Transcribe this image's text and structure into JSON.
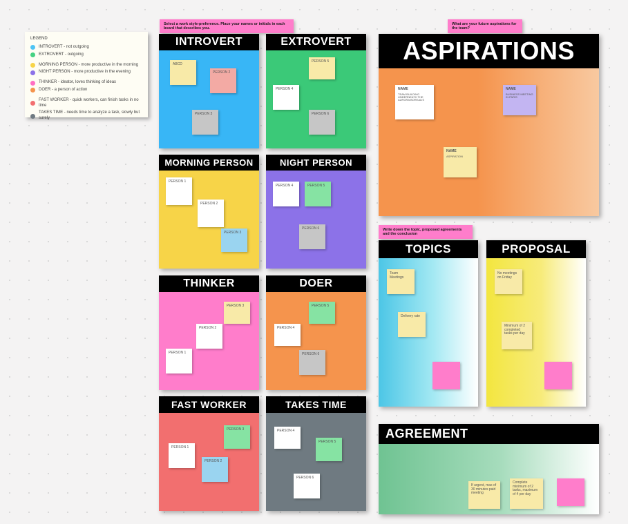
{
  "banners": {
    "workstyle": "Select a work style-preference. Place your names or initials in each board that describes you.",
    "aspirations": "What are your future aspirations for the team?",
    "agreements": "Write down the topic, proposed agreements and the conclusion"
  },
  "legend": {
    "title": "LEGEND",
    "items": [
      {
        "color": "#4fc4f4",
        "text": "INTROVERT - not outgoing"
      },
      {
        "color": "#46d183",
        "text": "EXTROVERT - outgoing"
      },
      {
        "gap": true
      },
      {
        "color": "#f7d448",
        "text": "MORNING PERSON - more productive in the morning"
      },
      {
        "color": "#8c72e8",
        "text": "NIGHT PERSON - more productive in the evening"
      },
      {
        "gap": true
      },
      {
        "color": "#ff6fc3",
        "text": "THINKER - ideator, loves thinking of ideas"
      },
      {
        "color": "#f5944d",
        "text": "DOER - a person of action"
      },
      {
        "gap": true
      },
      {
        "color": "#f26f6f",
        "text": "FAST WORKER - quick workers, can finish tasks in no time"
      },
      {
        "color": "#6f7a81",
        "text": "TAKES TIME - needs time to analyze a task, slowly but surely"
      }
    ]
  },
  "boards": {
    "introvert": {
      "title": "INTROVERT",
      "notes": [
        "ABCD",
        "PERSON 2",
        "PERSON 3"
      ]
    },
    "extrovert": {
      "title": "EXTROVERT",
      "notes": [
        "PERSON 5",
        "PERSON 4",
        "PERSON 6"
      ]
    },
    "morning": {
      "title": "MORNING PERSON",
      "notes": [
        "PERSON 1",
        "PERSON 2",
        "PERSON 3"
      ]
    },
    "night": {
      "title": "NIGHT PERSON",
      "notes": [
        "PERSON 4",
        "PERSON 5",
        "PERSON 6"
      ]
    },
    "thinker": {
      "title": "THINKER",
      "notes": [
        "PERSON 3",
        "PERSON 2",
        "PERSON 1"
      ]
    },
    "doer": {
      "title": "DOER",
      "notes": [
        "PERSON 5",
        "PERSON 4",
        "PERSON 6"
      ]
    },
    "fast": {
      "title": "FAST WORKER",
      "notes": [
        "PERSON 3",
        "PERSON 1",
        "PERSON 2"
      ]
    },
    "takes": {
      "title": "TAKES TIME",
      "notes": [
        "PERSON 4",
        "PERSON 5",
        "PERSON 6"
      ]
    }
  },
  "aspirations": {
    "title": "ASPIRATIONS",
    "notes": [
      {
        "name": "NAME",
        "body": "TEAM BUILDING UNDERNEATH THE AURORA BOREALIS"
      },
      {
        "name": "NAME",
        "body": "BUSINESS MEETING IN PARIS"
      },
      {
        "name": "NAME",
        "body": "ASPIRATION"
      }
    ]
  },
  "topics": {
    "title": "TOPICS",
    "notes": [
      "Team Meetings",
      "Delivery rate",
      ""
    ]
  },
  "proposal": {
    "title": "PROPOSAL",
    "notes": [
      "No meetings on Friday",
      "Minimum of 2 completed tasks per day",
      ""
    ]
  },
  "agreement": {
    "title": "AGREEMENT",
    "notes": [
      "If urgent, max of 30 minutes paid meeting",
      "Complete minimum of 2 tasks, maximum of 4 per day",
      ""
    ]
  }
}
